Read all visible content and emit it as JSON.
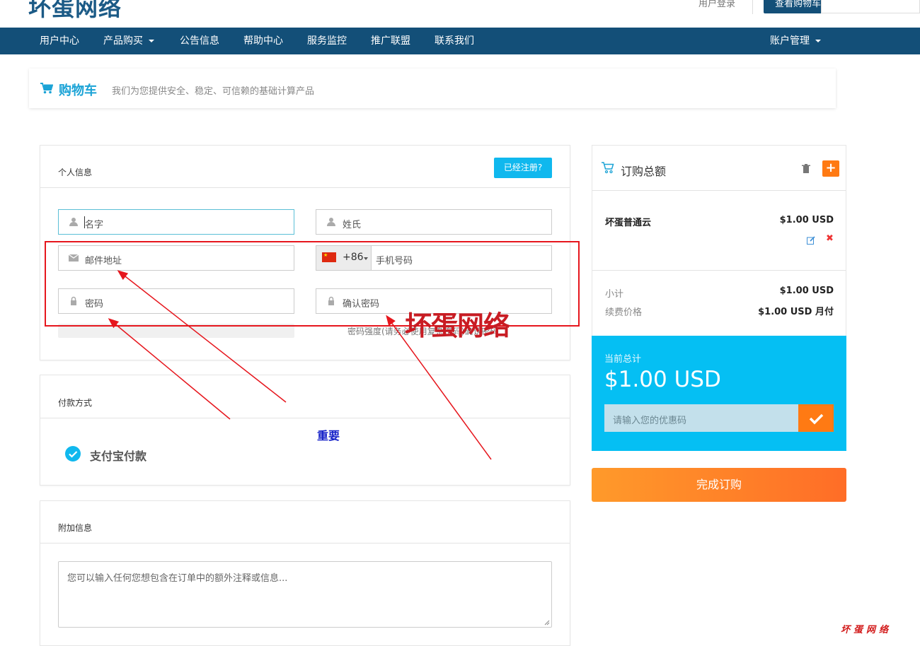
{
  "header": {
    "logo": "坏蛋网络",
    "login_link": "用户登录",
    "cart_button": "查看购物车"
  },
  "nav": {
    "items": [
      "用户中心",
      "产品购买",
      "公告信息",
      "帮助中心",
      "服务监控",
      "推广联盟",
      "联系我们"
    ],
    "account": "账户管理"
  },
  "page": {
    "title": "购物车",
    "subtitle": "我们为您提供安全、稳定、可信赖的基础计算产品"
  },
  "personal": {
    "title": "个人信息",
    "already_registered": "已经注册?",
    "first_name_placeholder": "名字",
    "last_name_placeholder": "姓氏",
    "email_placeholder": "邮件地址",
    "dial_code": "+86",
    "phone_placeholder": "手机号码",
    "password_placeholder": "密码",
    "confirm_password_placeholder": "确认密码",
    "password_hint": "密码强度(请务必使用复杂密码)确认密码"
  },
  "payment": {
    "title": "付款方式",
    "method": "支付宝付款"
  },
  "additional": {
    "title": "附加信息",
    "notes_placeholder": "您可以输入任何您想包含在订单中的额外注释或信息..."
  },
  "summary": {
    "title": "订购总额",
    "item_name": "坏蛋普通云",
    "item_price": "$1.00 USD",
    "subtotal_label": "小计",
    "subtotal_value": "$1.00 USD",
    "recurring_label": "续费价格",
    "recurring_value": "$1.00 USD 月付",
    "total_label": "当前总计",
    "total_value": "$1.00 USD",
    "promo_placeholder": "请输入您的优惠码",
    "checkout": "完成订购"
  },
  "annotations": {
    "big_label": "坏蛋网络",
    "important": "重要",
    "watermark": "坏蛋网络"
  },
  "colors": {
    "nav_bg": "#134f78",
    "accent_blue": "#10b8ee",
    "total_bg": "#05bff3",
    "orange": "#ff7a13",
    "annotation_red": "#e6161d"
  }
}
